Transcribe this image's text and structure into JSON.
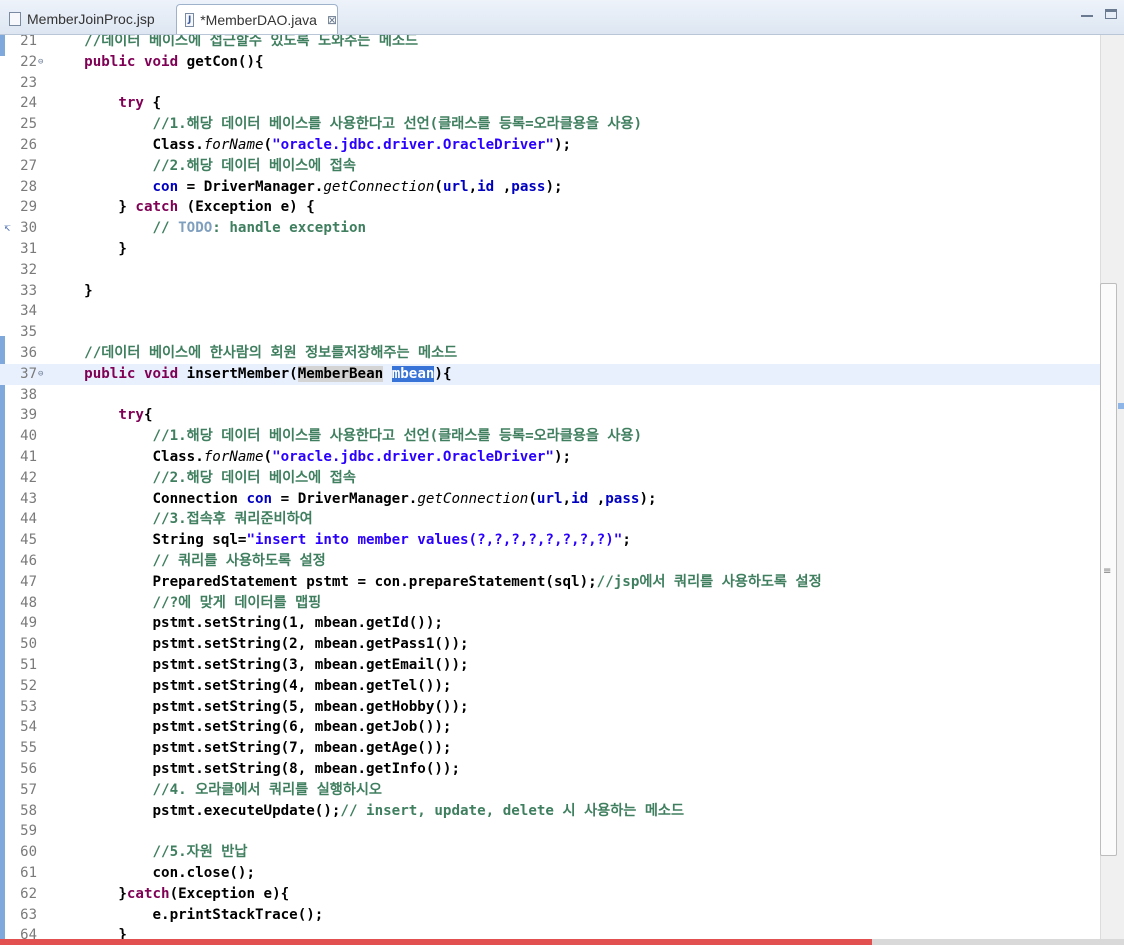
{
  "tabs": [
    {
      "label": "MemberJoinProc.jsp",
      "icon": "jsp-file-icon",
      "active": false
    },
    {
      "label": "*MemberDAO.java",
      "icon": "java-file-icon",
      "active": true,
      "close": "⊠"
    }
  ],
  "current_line": 37,
  "playback_progress": 0.776,
  "colors": {
    "keyword": "#7f0055",
    "comment": "#3f7f5f",
    "string": "#2a00ff",
    "field": "#0000c0",
    "selection": "#3874d8",
    "progress": "#e2514f"
  },
  "lines": [
    {
      "n": "21",
      "tokens": [
        [
          "cm",
          "    //데이터 베이스에 접근할수 있도록 도와주는 메소드"
        ]
      ]
    },
    {
      "n": "22",
      "fold": "⊖",
      "tokens": [
        [
          "t",
          "    "
        ],
        [
          "kw",
          "public void"
        ],
        [
          "t",
          " getCon(){"
        ]
      ]
    },
    {
      "n": "23",
      "tokens": []
    },
    {
      "n": "24",
      "tokens": [
        [
          "t",
          "        "
        ],
        [
          "kw",
          "try"
        ],
        [
          "t",
          " {"
        ]
      ]
    },
    {
      "n": "25",
      "tokens": [
        [
          "cm",
          "            //1.해당 데이터 베이스를 사용한다고 선언(클래스를 등록=오라클용을 사용)"
        ]
      ]
    },
    {
      "n": "26",
      "tokens": [
        [
          "t",
          "            Class."
        ],
        [
          "it",
          "forName"
        ],
        [
          "t",
          "("
        ],
        [
          "st",
          "\"oracle.jdbc.driver.OracleDriver\""
        ],
        [
          "t",
          ");"
        ]
      ]
    },
    {
      "n": "27",
      "tokens": [
        [
          "cm",
          "            //2.해당 데이터 베이스에 접속"
        ]
      ]
    },
    {
      "n": "28",
      "tokens": [
        [
          "t",
          "            "
        ],
        [
          "fd",
          "con"
        ],
        [
          "t",
          " = DriverManager."
        ],
        [
          "it",
          "getConnection"
        ],
        [
          "t",
          "("
        ],
        [
          "fd",
          "url"
        ],
        [
          "t",
          ","
        ],
        [
          "fd",
          "id"
        ],
        [
          "t",
          " ,"
        ],
        [
          "fd",
          "pass"
        ],
        [
          "t",
          ");"
        ]
      ]
    },
    {
      "n": "29",
      "tokens": [
        [
          "t",
          "        } "
        ],
        [
          "kw",
          "catch"
        ],
        [
          "t",
          " (Exception e) {"
        ]
      ]
    },
    {
      "n": "30",
      "mark": "↸",
      "tokens": [
        [
          "cm",
          "            // "
        ],
        [
          "td",
          "TODO"
        ],
        [
          "cm",
          ": handle exception"
        ]
      ]
    },
    {
      "n": "31",
      "tokens": [
        [
          "t",
          "        }"
        ]
      ]
    },
    {
      "n": "32",
      "tokens": []
    },
    {
      "n": "33",
      "tokens": [
        [
          "t",
          "    }"
        ]
      ]
    },
    {
      "n": "34",
      "tokens": []
    },
    {
      "n": "35",
      "tokens": []
    },
    {
      "n": "36",
      "tokens": [
        [
          "cm",
          "    //데이터 베이스에 한사람의 회원 정보를저장해주는 메소드"
        ]
      ]
    },
    {
      "n": "37",
      "fold": "⊖",
      "tokens": [
        [
          "t",
          "    "
        ],
        [
          "kw",
          "public void"
        ],
        [
          "t",
          " insertMember("
        ],
        [
          "occ",
          "MemberBean"
        ],
        [
          "t",
          " "
        ],
        [
          "sel",
          "mbean"
        ],
        [
          "t",
          "){"
        ]
      ]
    },
    {
      "n": "38",
      "tokens": []
    },
    {
      "n": "39",
      "tokens": [
        [
          "t",
          "        "
        ],
        [
          "kw",
          "try"
        ],
        [
          "t",
          "{"
        ]
      ]
    },
    {
      "n": "40",
      "tokens": [
        [
          "cm",
          "            //1.해당 데이터 베이스를 사용한다고 선언(클래스를 등록=오라클용을 사용)"
        ]
      ]
    },
    {
      "n": "41",
      "tokens": [
        [
          "t",
          "            Class."
        ],
        [
          "it",
          "forName"
        ],
        [
          "t",
          "("
        ],
        [
          "st",
          "\"oracle.jdbc.driver.OracleDriver\""
        ],
        [
          "t",
          ");"
        ]
      ]
    },
    {
      "n": "42",
      "tokens": [
        [
          "cm",
          "            //2.해당 데이터 베이스에 접속"
        ]
      ]
    },
    {
      "n": "43",
      "tokens": [
        [
          "t",
          "            Connection "
        ],
        [
          "fd",
          "con"
        ],
        [
          "t",
          " = DriverManager."
        ],
        [
          "it",
          "getConnection"
        ],
        [
          "t",
          "("
        ],
        [
          "fd",
          "url"
        ],
        [
          "t",
          ","
        ],
        [
          "fd",
          "id"
        ],
        [
          "t",
          " ,"
        ],
        [
          "fd",
          "pass"
        ],
        [
          "t",
          ");"
        ]
      ]
    },
    {
      "n": "44",
      "tokens": [
        [
          "cm",
          "            //3.접속후 쿼리준비하여"
        ]
      ]
    },
    {
      "n": "45",
      "tokens": [
        [
          "t",
          "            String sql="
        ],
        [
          "st",
          "\"insert into member values(?,?,?,?,?,?,?,?)\""
        ],
        [
          "t",
          ";"
        ]
      ]
    },
    {
      "n": "46",
      "tokens": [
        [
          "cm",
          "            // 쿼리를 사용하도록 설정"
        ]
      ]
    },
    {
      "n": "47",
      "tokens": [
        [
          "t",
          "            PreparedStatement pstmt = con.prepareStatement(sql);"
        ],
        [
          "cm",
          "//jsp에서 쿼리를 사용하도록 설정"
        ]
      ]
    },
    {
      "n": "48",
      "tokens": [
        [
          "cm",
          "            //?에 맞게 데이터를 맵핑"
        ]
      ]
    },
    {
      "n": "49",
      "tokens": [
        [
          "t",
          "            pstmt.setString(1, mbean.getId());"
        ]
      ]
    },
    {
      "n": "50",
      "tokens": [
        [
          "t",
          "            pstmt.setString(2, mbean.getPass1());"
        ]
      ]
    },
    {
      "n": "51",
      "tokens": [
        [
          "t",
          "            pstmt.setString(3, mbean.getEmail());"
        ]
      ]
    },
    {
      "n": "52",
      "tokens": [
        [
          "t",
          "            pstmt.setString(4, mbean.getTel());"
        ]
      ]
    },
    {
      "n": "53",
      "tokens": [
        [
          "t",
          "            pstmt.setString(5, mbean.getHobby());"
        ]
      ]
    },
    {
      "n": "54",
      "tokens": [
        [
          "t",
          "            pstmt.setString(6, mbean.getJob());"
        ]
      ]
    },
    {
      "n": "55",
      "tokens": [
        [
          "t",
          "            pstmt.setString(7, mbean.getAge());"
        ]
      ]
    },
    {
      "n": "56",
      "tokens": [
        [
          "t",
          "            pstmt.setString(8, mbean.getInfo());"
        ]
      ]
    },
    {
      "n": "57",
      "tokens": [
        [
          "cm",
          "            //4. 오라클에서 쿼리를 실행하시오"
        ]
      ]
    },
    {
      "n": "58",
      "tokens": [
        [
          "t",
          "            pstmt.executeUpdate();"
        ],
        [
          "cm",
          "// insert, update, delete 시 사용하는 메소드"
        ]
      ]
    },
    {
      "n": "59",
      "tokens": []
    },
    {
      "n": "60",
      "tokens": [
        [
          "cm",
          "            //5.자원 반납"
        ]
      ]
    },
    {
      "n": "61",
      "tokens": [
        [
          "t",
          "            con.close();"
        ]
      ]
    },
    {
      "n": "62",
      "tokens": [
        [
          "t",
          "        }"
        ],
        [
          "kw",
          "catch"
        ],
        [
          "t",
          "(Exception e){"
        ]
      ]
    },
    {
      "n": "63",
      "tokens": [
        [
          "t",
          "            e.printStackTrace();"
        ]
      ]
    },
    {
      "n": "64",
      "tokens": [
        [
          "t",
          "        }"
        ]
      ]
    }
  ]
}
